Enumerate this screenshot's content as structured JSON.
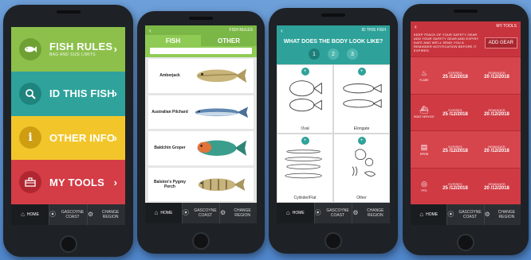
{
  "phone1": {
    "menu": [
      {
        "title": "FISH RULES",
        "subtitle": "BAG AND SIZE LIMITS",
        "icon": "fish-icon",
        "color": "#8cc04b",
        "circle": "#6fa034"
      },
      {
        "title": "ID THIS FISH",
        "subtitle": "",
        "icon": "search-icon",
        "color": "#2fa39b",
        "circle": "#1e847d"
      },
      {
        "title": "OTHER INFO",
        "subtitle": "",
        "icon": "info-icon",
        "color": "#f2c62b",
        "circle": "#cf9d12"
      },
      {
        "title": "MY TOOLS",
        "subtitle": "",
        "icon": "toolbox-icon",
        "color": "#d43c46",
        "circle": "#b02731"
      }
    ]
  },
  "nav": {
    "home": "HOME",
    "location": "GASCOYNE COAST",
    "change": "CHANGE REGION"
  },
  "phone2": {
    "header": "FISH RULES",
    "tabs": [
      "FISH",
      "OTHER"
    ],
    "fish": [
      {
        "name": "Amberjack",
        "color": "#c9b47a",
        "stripe": "#9c8a52"
      },
      {
        "name": "Australian Pilchard",
        "color": "#5e86b0",
        "stripe": "#9fc1e0"
      },
      {
        "name": "Baldchin Groper",
        "color": "#3b9e8c",
        "stripe": "#e2733a"
      },
      {
        "name": "Balston's Pygmy Perch",
        "color": "#c7b37c",
        "stripe": "#6f5f3a"
      }
    ]
  },
  "phone3": {
    "header": "ID THIS FISH",
    "question": "WHAT DOES THE BODY LOOK LIKE?",
    "steps": [
      "1",
      "2",
      "3"
    ],
    "shapes": [
      "Oval",
      "Elongate",
      "Cylinder/Flat",
      "Other"
    ]
  },
  "phone4": {
    "header": "MY TOOLS",
    "intro": "KEEP TRACK OF YOUR SAFETY GEAR. ADD YOUR SAFETY GEAR AND EXPIRY DATE AND WE'LL SEND YOU A REMINDER NOTIFICATION BEFORE IT EXPIRES.",
    "add_gear": "ADD GEAR",
    "expires_label": "EXPIRES",
    "reminder_label": "REMINDER",
    "gear": [
      {
        "name": "FLARE",
        "icon": "flame-icon",
        "expires": "25 /12/2018",
        "reminder": "20 /12/2018"
      },
      {
        "name": "BOAT SERVICE",
        "icon": "boat-icon",
        "expires": "25 /12/2018",
        "reminder": "20 /12/2018"
      },
      {
        "name": "EPIRB",
        "icon": "beacon-icon",
        "expires": "25 /12/2018",
        "reminder": "20 /12/2018"
      },
      {
        "name": "PFD",
        "icon": "lifebuoy-icon",
        "expires": "25 /12/2018",
        "reminder": "20 /12/2018"
      }
    ]
  }
}
